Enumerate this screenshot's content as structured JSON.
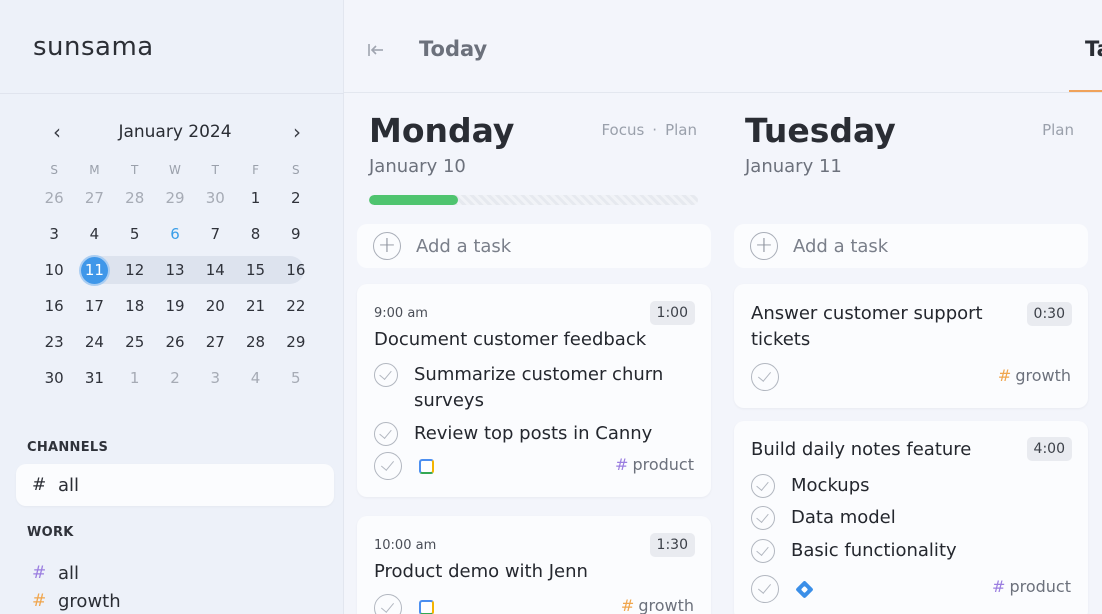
{
  "app": {
    "logo": "sunsama"
  },
  "calendar": {
    "month_label": "January 2024",
    "prev_icon": "chevron-left-icon",
    "next_icon": "chevron-right-icon",
    "weekdays": [
      "S",
      "M",
      "T",
      "W",
      "T",
      "F",
      "S"
    ],
    "weeks": [
      [
        "26",
        "27",
        "28",
        "29",
        "30",
        "1",
        "2"
      ],
      [
        "3",
        "4",
        "5",
        "6",
        "7",
        "8",
        "9"
      ],
      [
        "10",
        "11",
        "12",
        "13",
        "14",
        "15",
        "16"
      ],
      [
        "16",
        "17",
        "18",
        "19",
        "20",
        "21",
        "22"
      ],
      [
        "23",
        "24",
        "25",
        "26",
        "27",
        "28",
        "29"
      ],
      [
        "30",
        "31",
        "1",
        "2",
        "3",
        "4",
        "5"
      ]
    ],
    "selected_day": "11",
    "today_day": "6"
  },
  "sidebar": {
    "channels_header": "CHANNELS",
    "channels_item": {
      "hash": "#",
      "label": "all"
    },
    "work_header": "WORK",
    "work_items": [
      {
        "hash": "#",
        "label": "all"
      },
      {
        "hash": "#",
        "label": "growth"
      }
    ]
  },
  "topbar": {
    "collapse_icon": "collapse-left-icon",
    "title": "Today",
    "cut_tab": "Ta",
    "accent": "#f0a25a"
  },
  "monday": {
    "name": "Monday",
    "date": "January 10",
    "link_focus": "Focus",
    "link_sep": "·",
    "link_plan": "Plan",
    "progress_fraction": 0.27,
    "add_task": "Add a task",
    "cards": [
      {
        "time": "9:00 am",
        "title": "Document customer feedback",
        "duration": "1:00",
        "subtasks": [
          "Summarize customer churn surveys",
          "Review top posts in Canny"
        ],
        "tag_hash": "#",
        "tag": "product"
      },
      {
        "time": "10:00 am",
        "title": "Product demo with Jenn",
        "duration": "1:30",
        "tag_hash": "#",
        "tag": "growth"
      }
    ]
  },
  "tuesday": {
    "name": "Tuesday",
    "date": "January 11",
    "link_plan": "Plan",
    "add_task": "Add a task",
    "cards": [
      {
        "title": "Answer customer support tickets",
        "duration": "0:30",
        "tag_hash": "#",
        "tag": "growth"
      },
      {
        "title": "Build daily notes feature",
        "duration": "4:00",
        "subtasks": [
          "Mockups",
          "Data model",
          "Basic functionality"
        ],
        "tag_hash": "#",
        "tag": "product"
      }
    ]
  },
  "colors": {
    "progress": "#4fc46f",
    "selected_day": "#3f97e9",
    "product_hash": "#9b7ee0",
    "growth_hash": "#f0a64e"
  }
}
